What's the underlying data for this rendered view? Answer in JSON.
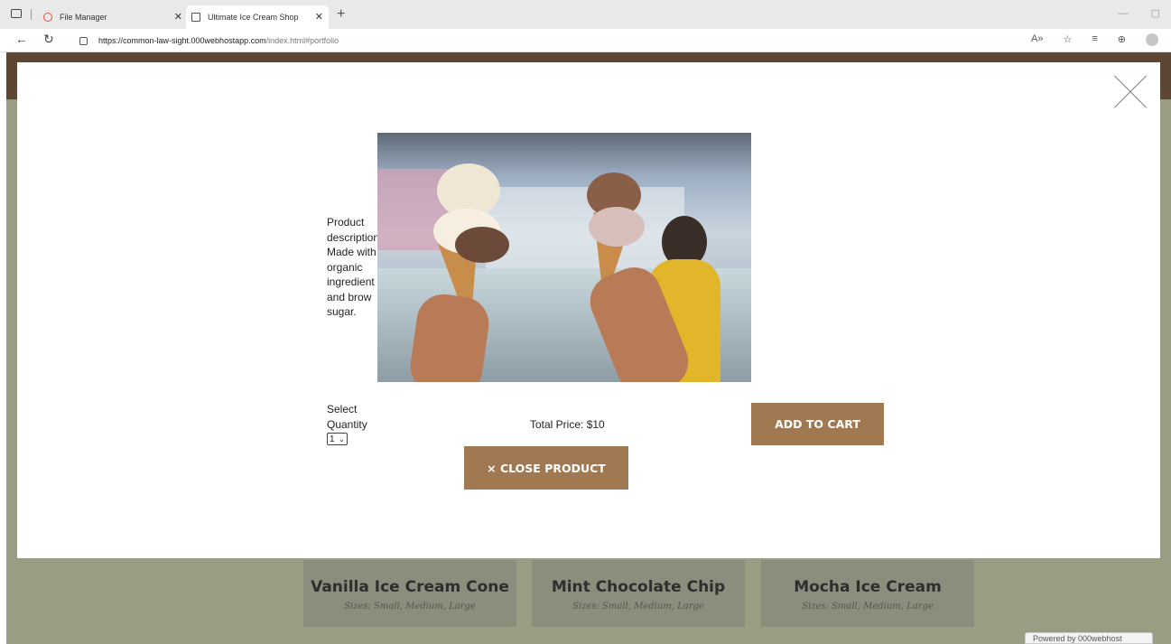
{
  "browser": {
    "tabs": [
      {
        "label": "File Manager"
      },
      {
        "label": "Ultimate Ice Cream Shop"
      }
    ],
    "new_tab_symbol": "+",
    "url_main": "https://common-law-sight.000webhostapp.com",
    "url_rest": "/index.html#portfolio",
    "controls": {
      "minimize": "—",
      "maximize": "▢"
    }
  },
  "modal": {
    "description": "Product description: Made with organic ingredient and brow sugar.",
    "quantity_label": "Select Quantity",
    "quantity_value": "1",
    "total_price": "Total Price: $10",
    "add_to_cart_label": "ADD TO CART",
    "close_product_label": "× CLOSE PRODUCT",
    "close_icon": "x-icon"
  },
  "products": [
    {
      "title": "Vanilla Ice Cream Cone",
      "sizes": "Sizes: Small, Medium, Large"
    },
    {
      "title": "Mint Chocolate Chip",
      "sizes": "Sizes: Small, Medium, Large"
    },
    {
      "title": "Mocha Ice Cream",
      "sizes": "Sizes: Small, Medium, Large"
    }
  ],
  "footer_badge": "Powered by 000webhost",
  "colors": {
    "button_brown": "#a07851",
    "page_olive": "#9b9c84",
    "header_brown": "#5d4633"
  }
}
